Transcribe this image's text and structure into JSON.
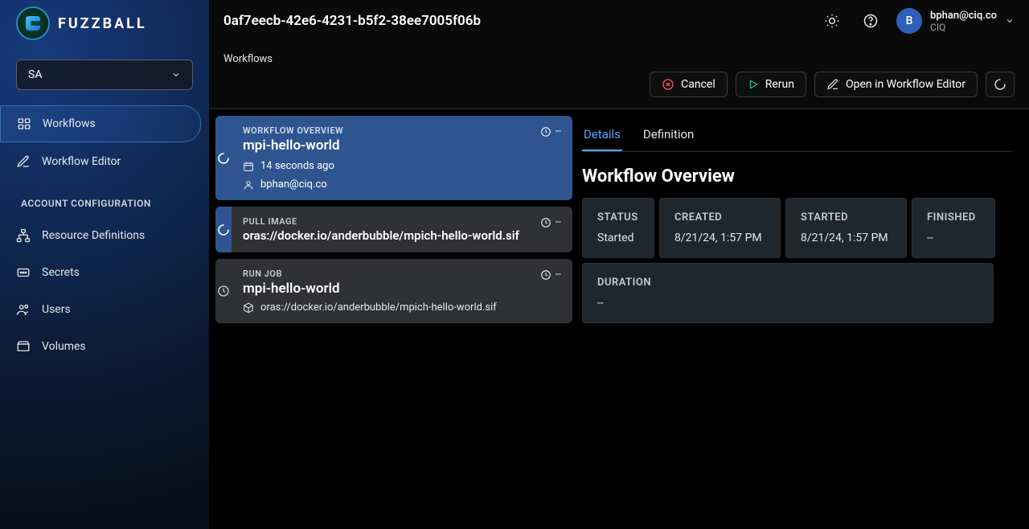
{
  "brand": "FUZZBALL",
  "header": {
    "title": "0af7eecb-42e6-4231-b5f2-38ee7005f06b",
    "user_email": "bphan@ciq.co",
    "user_org": "CIQ",
    "avatar_initial": "B"
  },
  "sidebar": {
    "context_selected": "SA",
    "nav": {
      "workflows": "Workflows",
      "editor": "Workflow Editor"
    },
    "section_label": "ACCOUNT CONFIGURATION",
    "config": {
      "resource_defs": "Resource Definitions",
      "secrets": "Secrets",
      "users": "Users",
      "volumes": "Volumes"
    }
  },
  "toolbar": {
    "breadcrumb": "Workflows",
    "cancel": "Cancel",
    "rerun": "Rerun",
    "open_editor": "Open in Workflow Editor"
  },
  "steps": {
    "overview": {
      "kicker": "WORKFLOW OVERVIEW",
      "title": "mpi-hello-world",
      "elapsed": "--",
      "time_ago": "14 seconds ago",
      "user": "bphan@ciq.co"
    },
    "pull": {
      "kicker": "PULL IMAGE",
      "title": "oras://docker.io/anderbubble/mpich-hello-world.sif",
      "elapsed": "--"
    },
    "run": {
      "kicker": "RUN JOB",
      "title": "mpi-hello-world",
      "pkg": "oras://docker.io/anderbubble/mpich-hello-world.sif",
      "elapsed": "--"
    }
  },
  "details": {
    "tab_details": "Details",
    "tab_definition": "Definition",
    "heading": "Workflow Overview",
    "stats": {
      "status_label": "STATUS",
      "status_value": "Started",
      "created_label": "CREATED",
      "created_value": "8/21/24, 1:57 PM",
      "started_label": "STARTED",
      "started_value": "8/21/24, 1:57 PM",
      "finished_label": "FINISHED",
      "finished_value": "--",
      "duration_label": "DURATION",
      "duration_value": "--"
    }
  }
}
